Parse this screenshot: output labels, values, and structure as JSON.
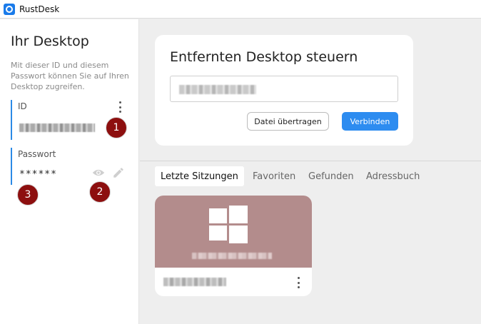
{
  "window": {
    "title": "RustDesk",
    "icon": "rustdesk-logo-icon"
  },
  "left_panel": {
    "title": "Ihr Desktop",
    "description": "Mit dieser ID und diesem Passwort können Sie auf Ihren Desktop zugreifen.",
    "id_field": {
      "label": "ID"
    },
    "password_field": {
      "label": "Passwort",
      "value": "******"
    }
  },
  "annotations": [
    "1",
    "2",
    "3"
  ],
  "connect_card": {
    "title": "Entfernten Desktop steuern",
    "transfer_button": "Datei übertragen",
    "connect_button": "Verbinden"
  },
  "tabs": [
    {
      "label": "Letzte Sitzungen",
      "active": true
    },
    {
      "label": "Favoriten",
      "active": false
    },
    {
      "label": "Gefunden",
      "active": false
    },
    {
      "label": "Adressbuch",
      "active": false
    }
  ],
  "session_card": {
    "os_icon": "windows-logo-icon"
  },
  "colors": {
    "accent": "#2d8cf0",
    "badge": "#8d0f0f",
    "thumbnail": "#b38c8c"
  }
}
